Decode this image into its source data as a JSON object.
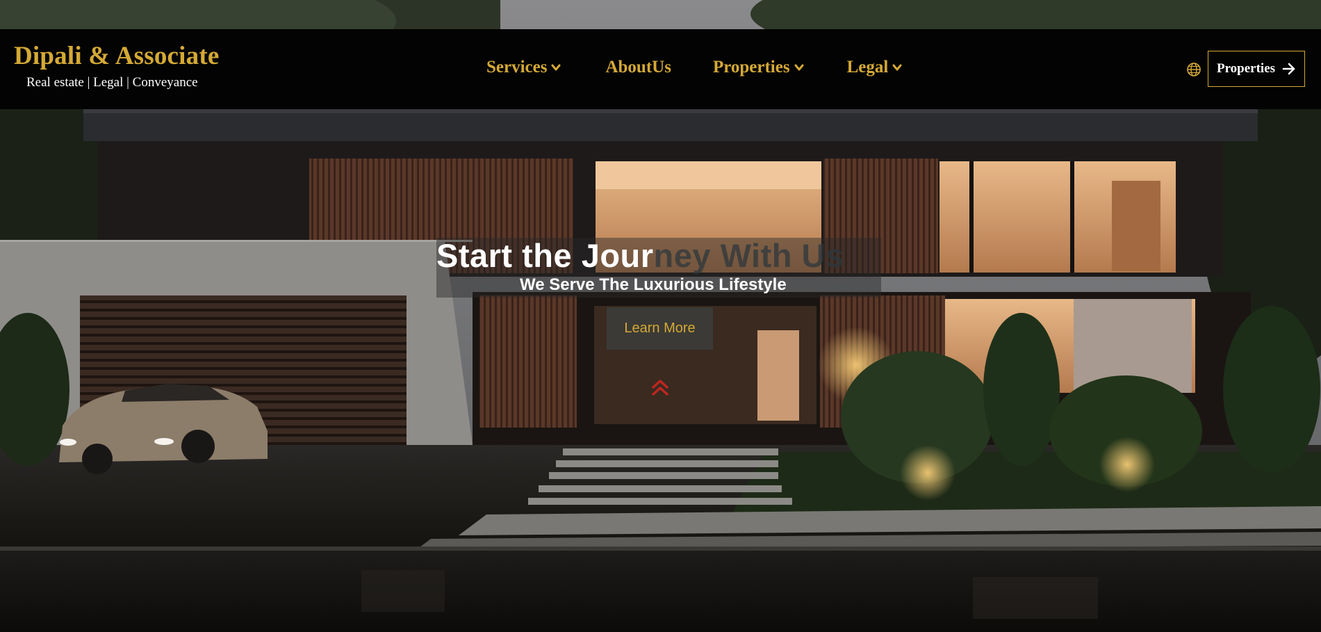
{
  "brand": {
    "name": "Dipali & Associate",
    "tagline": "Real estate | Legal | Conveyance"
  },
  "nav": {
    "items": [
      {
        "label": "Services",
        "icon": "chevron-down-icon"
      },
      {
        "label": "AboutUs"
      },
      {
        "label": "Properties",
        "icon": "chevron-down-icon"
      },
      {
        "label": "Legal",
        "icon": "chevron-down-icon"
      }
    ],
    "language_icon": "globe-icon",
    "cta_label": "Properties",
    "cta_icon": "arrow-right-icon"
  },
  "hero": {
    "title_visible": "Start the Jour",
    "title_fading": "ney With Us",
    "subtitle": "We Serve The Luxurious Lifestyle",
    "button_label": "Learn More",
    "scroll_icon": "double-chevron-up-icon"
  },
  "colors": {
    "accent_gold": "#d4a935",
    "navbar_bg": "#030303",
    "scroll_icon": "#c0261f"
  }
}
